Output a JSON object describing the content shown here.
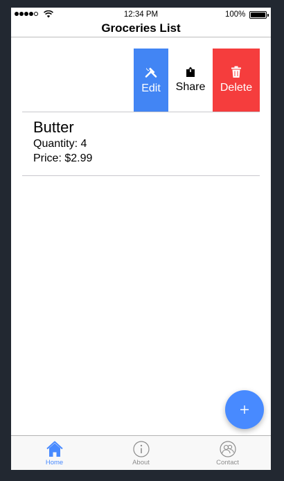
{
  "status": {
    "time": "12:34 PM",
    "battery": "100%"
  },
  "nav": {
    "title": "Groceries List"
  },
  "item_actions": {
    "edit": "Edit",
    "share": "Share",
    "delete": "Delete"
  },
  "items": [
    {
      "name": "Butter",
      "quantity": "Quantity: 4",
      "price": "Price: $2.99"
    }
  ],
  "fab": {
    "icon": "plus-icon"
  },
  "tabs": [
    {
      "label": "Home",
      "icon": "home-icon",
      "active": true
    },
    {
      "label": "About",
      "icon": "info-icon",
      "active": false
    },
    {
      "label": "Contact",
      "icon": "contacts-icon",
      "active": false
    }
  ],
  "colors": {
    "primary": "#488aff",
    "edit": "#4285f4",
    "danger": "#f53d3d",
    "background": "#222831"
  }
}
